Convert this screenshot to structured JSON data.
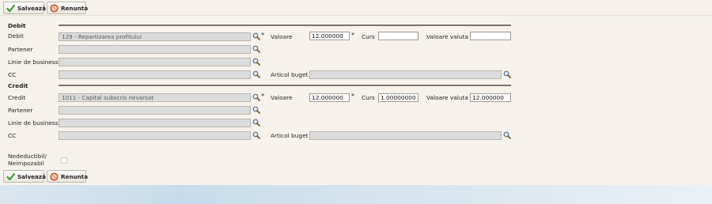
{
  "toolbar": {
    "save_label": "Salvează",
    "cancel_label": "Renunta"
  },
  "debit": {
    "title": "Debit",
    "account_label": "Debit",
    "account_value": "129 - Repartizarea profitului",
    "partner_label": "Partener",
    "business_line_label": "Linie de business",
    "cc_label": "CC",
    "amount_label": "Valoare",
    "amount_value": "12.000000",
    "rate_label": "Curs",
    "rate_value": "",
    "currency_amount_label": "Valoare valuta",
    "currency_amount_value": "",
    "budget_item_label": "Articol buget"
  },
  "credit": {
    "title": "Credit",
    "account_label": "Credit",
    "account_value": "1011 - Capital subscris nevarsat",
    "partner_label": "Partener",
    "business_line_label": "Linie de business",
    "cc_label": "CC",
    "amount_label": "Valoare",
    "amount_value": "12.000000",
    "rate_label": "Curs",
    "rate_value": "1.00000000",
    "currency_amount_label": "Valoare valuta",
    "currency_amount_value": "12.000000",
    "budget_item_label": "Articol buget"
  },
  "nondeductible": {
    "label_line1": "Nedeductibil/",
    "label_line2": "Neimpozabil",
    "checked": false
  },
  "required_marker": "*",
  "icons": {
    "save": "checkmark-icon",
    "cancel": "cancel-circle-icon",
    "lookup": "magnifier-icon"
  },
  "colors": {
    "background": "#f7f3ec",
    "save_icon": "#2e9a2e",
    "cancel_icon": "#e0602a",
    "readonly_field": "#dcdcdc"
  }
}
